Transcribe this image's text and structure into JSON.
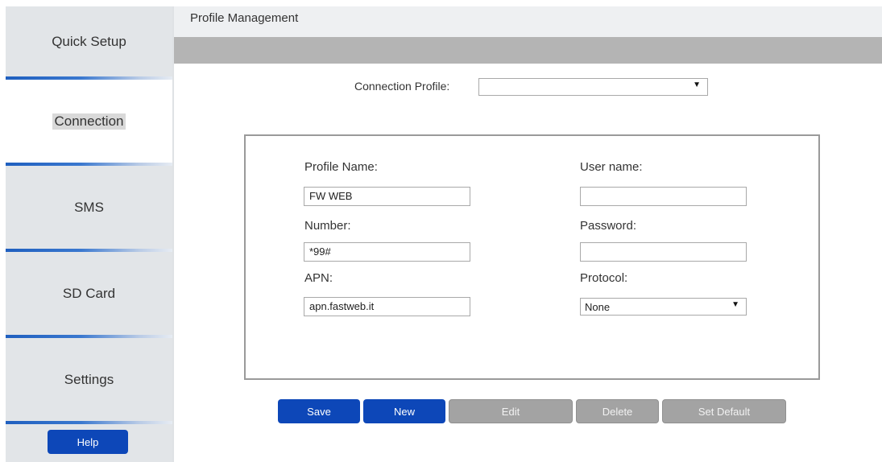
{
  "sidebar": {
    "items": [
      {
        "label": "Quick Setup"
      },
      {
        "label": "Connection"
      },
      {
        "label": "SMS"
      },
      {
        "label": "SD Card"
      },
      {
        "label": "Settings"
      }
    ],
    "active": "Connection",
    "help_label": "Help"
  },
  "header": {
    "title": "Profile Management"
  },
  "connection_profile": {
    "label": "Connection Profile:",
    "selected": ""
  },
  "form": {
    "profile_name": {
      "label": "Profile Name:",
      "value": "FW WEB"
    },
    "number": {
      "label": "Number:",
      "value": "*99#"
    },
    "apn": {
      "label": "APN:",
      "value": "apn.fastweb.it"
    },
    "user_name": {
      "label": "User name:",
      "value": ""
    },
    "password": {
      "label": "Password:",
      "value": ""
    },
    "protocol": {
      "label": "Protocol:",
      "selected": "None"
    }
  },
  "buttons": {
    "save": "Save",
    "new": "New",
    "edit": "Edit",
    "delete": "Delete",
    "set_default": "Set Default"
  },
  "colors": {
    "primary_button": "#0d47b8",
    "disabled_button": "#a3a3a3",
    "sidebar_bg": "#e2e5e8",
    "accent_separator": "#1f5fbf"
  }
}
